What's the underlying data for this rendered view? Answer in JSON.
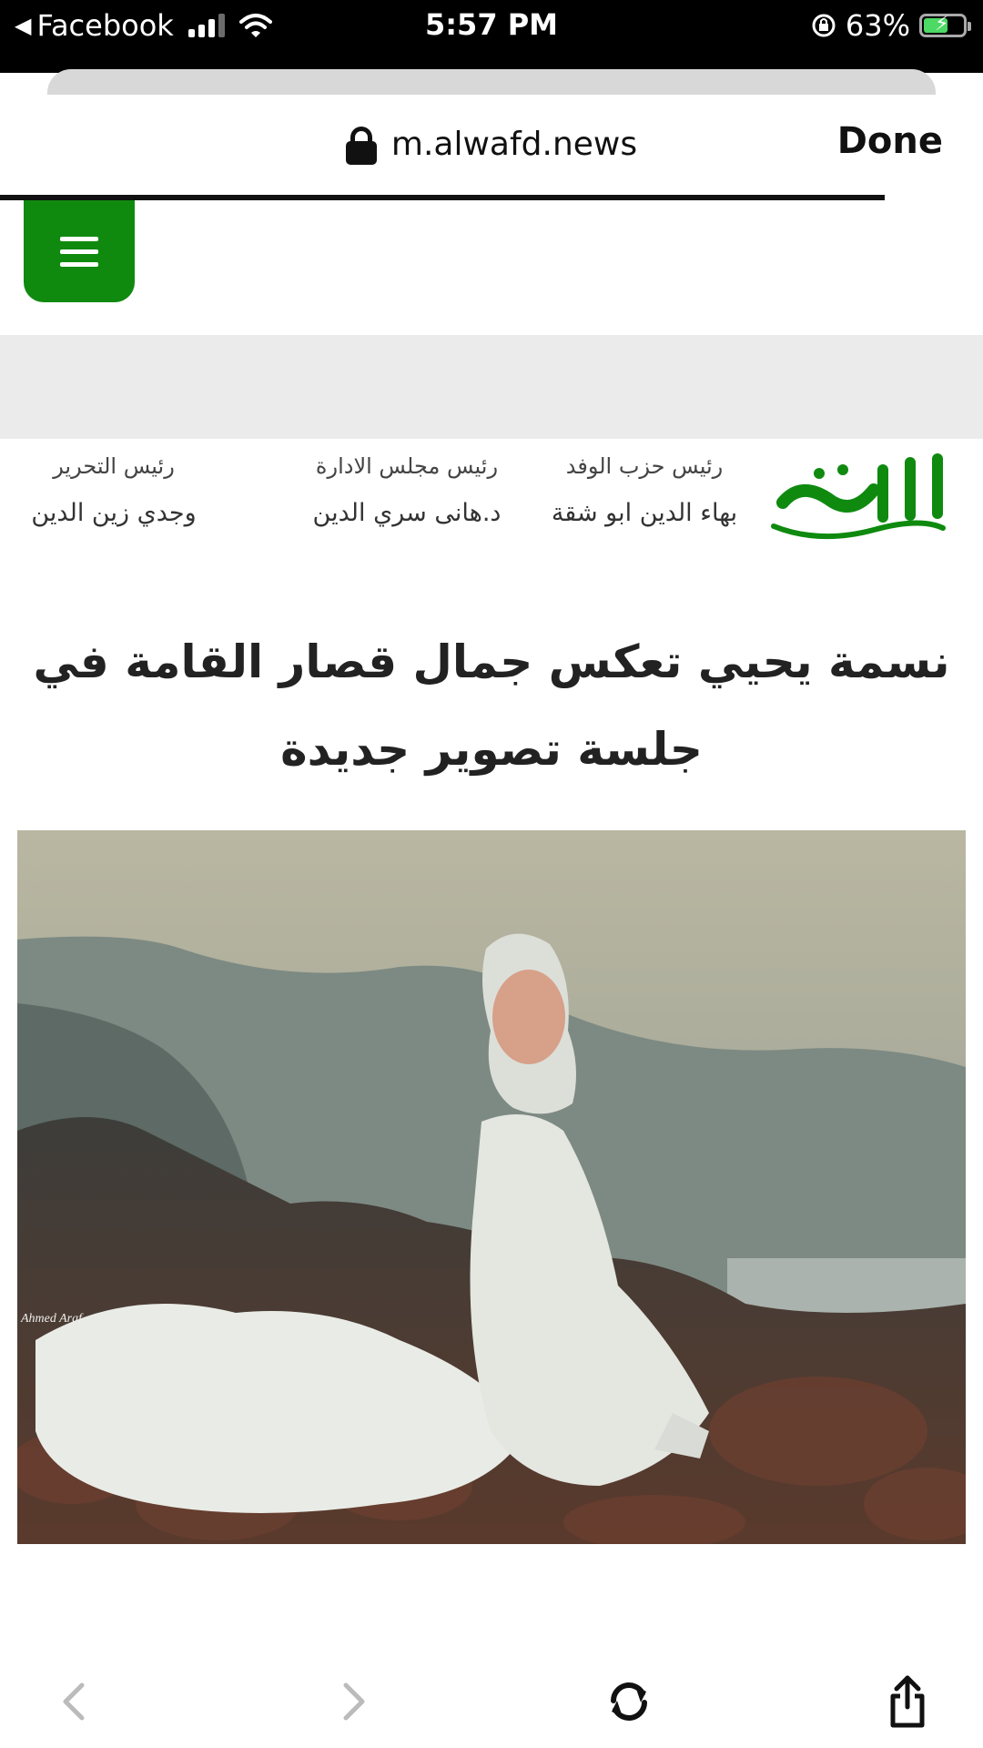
{
  "status_bar": {
    "back_app": "Facebook",
    "time": "5:57 PM",
    "battery_percent": "63%",
    "battery_level": 0.63
  },
  "browser": {
    "url": "m.alwafd.news",
    "done_label": "Done",
    "load_progress": 0.9
  },
  "site": {
    "logo_text": "الوفد",
    "brand_color": "#0f8a0f",
    "masthead": [
      {
        "label": "رئيس حزب الوفد",
        "name": "بهاء الدين ابو شقة"
      },
      {
        "label": "رئيس مجلس الادارة",
        "name": "د.هانى سري الدين"
      },
      {
        "label": "رئيس التحرير",
        "name": "وجدي زين الدين"
      }
    ]
  },
  "article": {
    "headline": "نسمة يحيي تعكس جمال قصار القامة في جلسة تصوير جديدة",
    "photo_credit": "Ahmed Araf"
  },
  "toolbar": {
    "back_icon": "chevron-left-icon",
    "forward_icon": "chevron-right-icon",
    "reload_icon": "reload-icon",
    "share_icon": "share-icon"
  }
}
